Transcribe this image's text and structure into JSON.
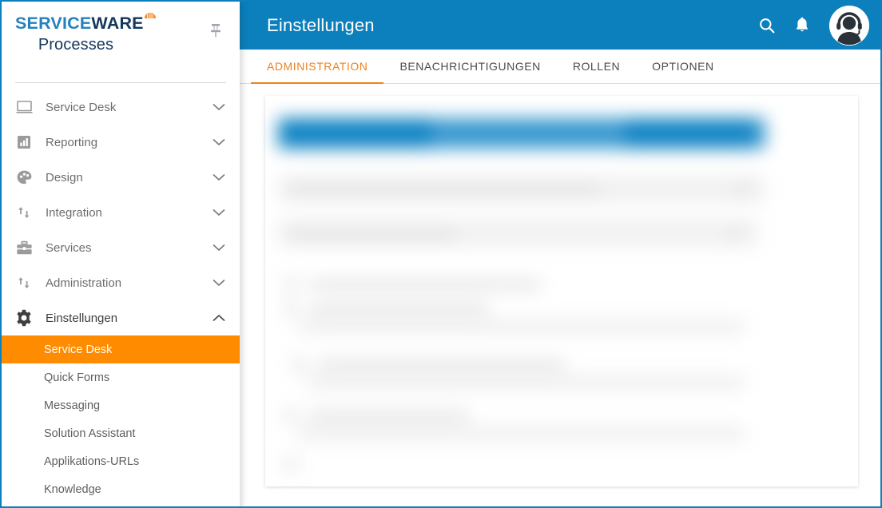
{
  "window": {
    "border_color": "#0b80bc"
  },
  "brand": {
    "wordmark_part1": "SERVICE",
    "wordmark_part2": "WARE",
    "product": "Processes",
    "pin_icon": "pushpin-icon",
    "colors": {
      "service_blue": "#2382bd",
      "ware_navy": "#14375e",
      "dome_orange": "#f5871f"
    }
  },
  "sidebar": {
    "items": [
      {
        "label": "Service Desk",
        "icon": "monitor-icon",
        "chevron": "chevron-down",
        "expanded": false
      },
      {
        "label": "Reporting",
        "icon": "bar-chart-icon",
        "chevron": "chevron-down",
        "expanded": false
      },
      {
        "label": "Design",
        "icon": "palette-icon",
        "chevron": "chevron-down",
        "expanded": false
      },
      {
        "label": "Integration",
        "icon": "transfer-icon",
        "chevron": "chevron-down",
        "expanded": false
      },
      {
        "label": "Services",
        "icon": "briefcase-icon",
        "chevron": "chevron-down",
        "expanded": false
      },
      {
        "label": "Administration",
        "icon": "transfer-icon",
        "chevron": "chevron-down",
        "expanded": false
      },
      {
        "label": "Einstellungen",
        "icon": "gear-icon",
        "chevron": "chevron-up",
        "expanded": true
      }
    ],
    "submenu": [
      {
        "label": "Service Desk",
        "active": true
      },
      {
        "label": "Quick Forms",
        "active": false
      },
      {
        "label": "Messaging",
        "active": false
      },
      {
        "label": "Solution Assistant",
        "active": false
      },
      {
        "label": "Applikations-URLs",
        "active": false
      },
      {
        "label": "Knowledge",
        "active": false
      }
    ],
    "active_color": "#ff8c00"
  },
  "header": {
    "title": "Einstellungen",
    "background": "#0b80bc",
    "actions": [
      {
        "name": "search-icon",
        "label": "Suche"
      },
      {
        "name": "notification-icon",
        "label": "Benachrichtigungen"
      }
    ],
    "avatar": {
      "name": "user-avatar-headset-icon",
      "label": "Benutzerprofil"
    }
  },
  "tabs": [
    {
      "label": "ADMINISTRATION",
      "active": true
    },
    {
      "label": "BENACHRICHTIGUNGEN",
      "active": false
    },
    {
      "label": "ROLLEN",
      "active": false
    },
    {
      "label": "OPTIONEN",
      "active": false
    }
  ],
  "content": {
    "state": "blurred",
    "note": "Inhalt unkenntlich gemacht"
  }
}
